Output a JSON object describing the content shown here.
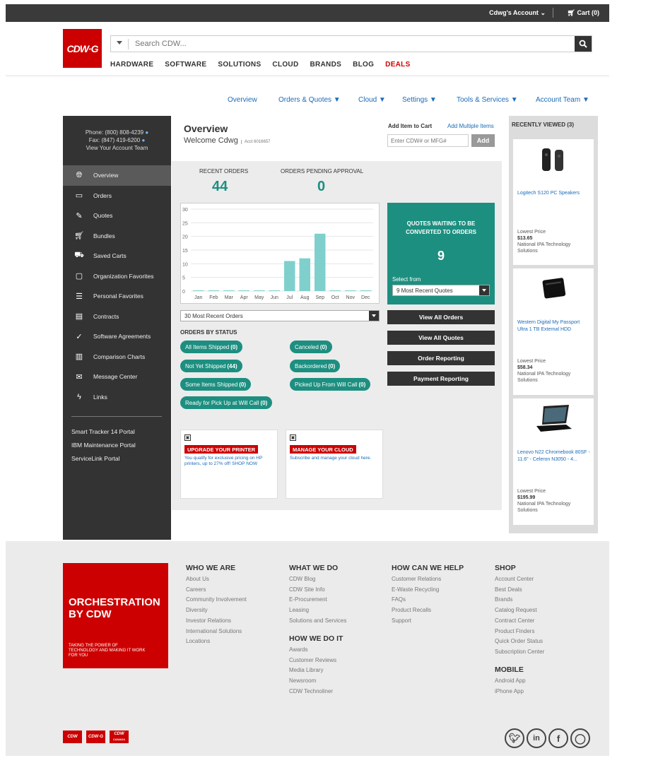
{
  "topbar": {
    "account": "Cdwg's Account",
    "cart": "Cart (0)"
  },
  "header": {
    "logo": "CDW·G",
    "search_placeholder": "Search CDW...",
    "nav": [
      "HARDWARE",
      "SOFTWARE",
      "SOLUTIONS",
      "CLOUD",
      "BRANDS",
      "BLOG",
      "DEALS"
    ]
  },
  "subnav": [
    "Overview",
    "Orders & Quotes ▼",
    "Cloud ▼",
    "Settings ▼",
    "Tools & Services ▼",
    "Account Team ▼"
  ],
  "sidebar": {
    "phone": "Phone: (800) 808-4239",
    "fax": "Fax: (847) 419-6200",
    "view_team": "View Your Account Team",
    "items": [
      {
        "label": "Overview",
        "icon": "globe-icon"
      },
      {
        "label": "Orders",
        "icon": "orders-icon"
      },
      {
        "label": "Quotes",
        "icon": "quotes-icon"
      },
      {
        "label": "Bundles",
        "icon": "cart-icon"
      },
      {
        "label": "Saved Carts",
        "icon": "saved-cart-icon"
      },
      {
        "label": "Organization Favorites",
        "icon": "org-favorites-icon"
      },
      {
        "label": "Personal Favorites",
        "icon": "list-icon"
      },
      {
        "label": "Contracts",
        "icon": "contract-icon"
      },
      {
        "label": "Software Agreements",
        "icon": "check-circle-icon"
      },
      {
        "label": "Comparison Charts",
        "icon": "compare-icon"
      },
      {
        "label": "Message Center",
        "icon": "message-icon"
      },
      {
        "label": "Links",
        "icon": "bolt-icon"
      }
    ],
    "portals": [
      "Smart Tracker 14 Portal",
      "IBM Maintenance Portal",
      "ServiceLink Portal"
    ]
  },
  "overview": {
    "title": "Overview",
    "welcome": "Welcome Cdwg",
    "acct": "Acct 6016657",
    "add_to_cart_title": "Add Item to Cart",
    "add_multiple": "Add Multiple Items",
    "add_placeholder": "Enter CDW# or MFG#",
    "add_button": "Add",
    "recent_orders_label": "RECENT ORDERS",
    "recent_orders_value": "44",
    "pending_label": "ORDERS PENDING APPROVAL",
    "pending_value": "0",
    "orders_select": "30 Most Recent Orders",
    "status_title": "ORDERS BY STATUS",
    "statuses": [
      {
        "label": "All Items Shipped",
        "count": "(0)"
      },
      {
        "label": "Canceled",
        "count": "(0)"
      },
      {
        "label": "Not Yet Shipped",
        "count": "(44)"
      },
      {
        "label": "Backordered",
        "count": "(0)"
      },
      {
        "label": "Some Items Shipped",
        "count": "(0)"
      },
      {
        "label": "Picked Up From Will Call",
        "count": "(0)"
      },
      {
        "label": "Ready for Pick Up at Will Call",
        "count": "(0)"
      }
    ],
    "quotes_title_1": "QUOTES WAITING TO BE",
    "quotes_title_2": "CONVERTED TO ORDERS",
    "quotes_value": "9",
    "select_from": "Select from",
    "quotes_select": "9 Most Recent Quotes",
    "buttons": [
      "View All Orders",
      "View All Quotes",
      "Order Reporting",
      "Payment Reporting"
    ],
    "promos": [
      {
        "title": "UPGRADE YOUR PRINTER",
        "text": "You qualify for exclusive pricing on HP printers, up to 27% off! SHOP NOW"
      },
      {
        "title": "MANAGE YOUR CLOUD",
        "text": "Subscribe and manage your cloud here."
      }
    ]
  },
  "chart_data": {
    "type": "bar",
    "categories": [
      "Jan",
      "Feb",
      "Mar",
      "Apr",
      "May",
      "Jun",
      "Jul",
      "Aug",
      "Sep",
      "Oct",
      "Nov",
      "Dec"
    ],
    "values": [
      0,
      0,
      0,
      0,
      0,
      0,
      11,
      12,
      21,
      0,
      0,
      0
    ],
    "ylim": [
      0,
      30
    ],
    "yticks": [
      0,
      5,
      10,
      15,
      20,
      25,
      30
    ],
    "color": "#7fd0cc",
    "grid": true
  },
  "recently_viewed": {
    "title": "RECENTLY VIEWED (3)",
    "items": [
      {
        "name": "Logitech S120 PC Speakers",
        "price_label": "Lowest Price",
        "price": "$13.65",
        "seller": "National IPA Technology Solutions"
      },
      {
        "name": "Western Digital My Passport Ultra 1 TB External HDD",
        "price_label": "Lowest Price",
        "price": "$58.34",
        "seller": "National IPA Technology Solutions"
      },
      {
        "name": "Lenovo N22 Chromebook 80SF - 11.6\" - Celeron N3050 - 4...",
        "price_label": "Lowest Price",
        "price": "$195.99",
        "seller": "National IPA Technology Solutions"
      }
    ]
  },
  "footer": {
    "brand_title": "ORCHESTRATION BY CDW",
    "brand_sub": "TAKING THE POWER OF TECHNOLOGY AND MAKING IT WORK FOR YOU",
    "who": {
      "title": "WHO WE ARE",
      "links": [
        "About Us",
        "Careers",
        "Community Involvement",
        "Diversity",
        "Investor Relations",
        "International Solutions",
        "Locations"
      ]
    },
    "what": {
      "title": "WHAT WE DO",
      "links": [
        "CDW Blog",
        "CDW Site Info",
        "E-Procurement",
        "Leasing",
        "Solutions and Services"
      ]
    },
    "how": {
      "title": "HOW WE DO IT",
      "links": [
        "Awards",
        "Customer Reviews",
        "Media Library",
        "Newsroom",
        "CDW Technoliner"
      ]
    },
    "help": {
      "title": "HOW CAN WE HELP",
      "links": [
        "Customer Relations",
        "E-Waste Recycling",
        "FAQs",
        "Product Recalls",
        "Support"
      ]
    },
    "shop": {
      "title": "SHOP",
      "links": [
        "Account Center",
        "Best Deals",
        "Brands",
        "Catalog Request",
        "Contract Center",
        "Product Finders",
        "Quick Order Status",
        "Subscription Center"
      ]
    },
    "mobile": {
      "title": "MOBILE",
      "links": [
        "Android App",
        "iPhone App"
      ]
    },
    "logos": [
      "CDW",
      "CDW·G",
      "CDW"
    ],
    "canada": "CANADA"
  }
}
